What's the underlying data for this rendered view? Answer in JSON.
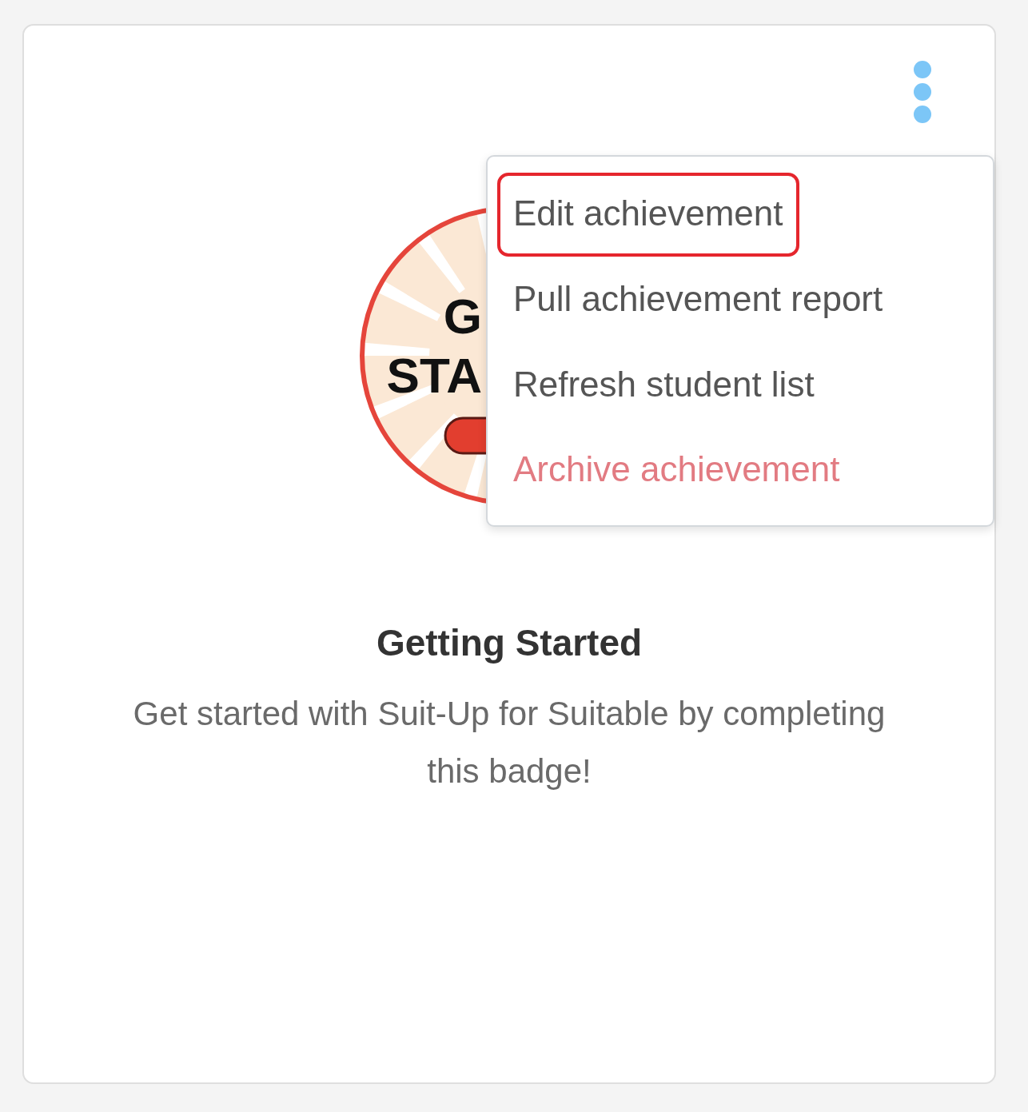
{
  "card": {
    "badge": {
      "kind": "picture",
      "lines": [
        "G",
        "STA"
      ]
    },
    "title": "Getting Started",
    "description": "Get started with Suit-Up for Suitable by completing this badge!",
    "menu": {
      "expanded": true,
      "items": [
        {
          "label": "Edit achievement",
          "kind": "normal",
          "highlighted": true
        },
        {
          "label": "Pull achievement report",
          "kind": "normal",
          "highlighted": false
        },
        {
          "label": "Refresh student list",
          "kind": "normal",
          "highlighted": false
        },
        {
          "label": "Archive achievement",
          "kind": "danger",
          "highlighted": false
        }
      ]
    }
  }
}
